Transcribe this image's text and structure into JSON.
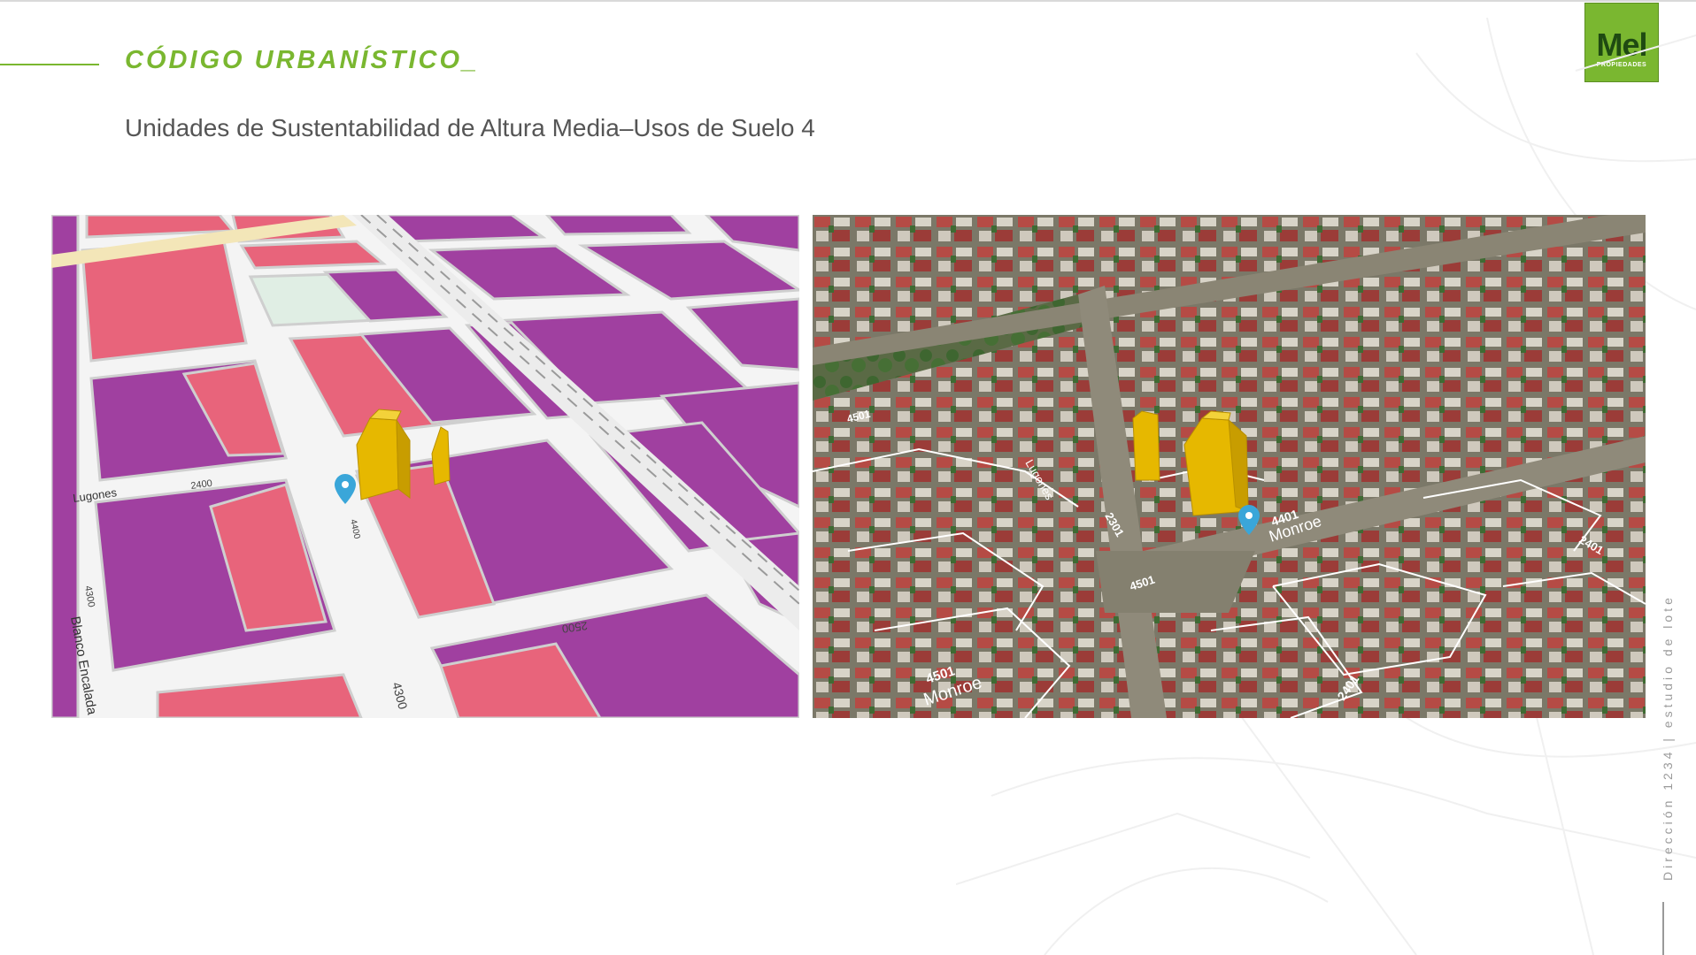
{
  "header": {
    "section_title": "CÓDIGO URBANÍSTICO_",
    "subtitle": "Unidades de Sustentabilidad de Altura Media–Usos de Suelo 4"
  },
  "logo": {
    "main": "Mel",
    "sub": "PROPIEDADES"
  },
  "map": {
    "labels": {
      "lugones": "Lugones",
      "blanco": "Blanco Encalada",
      "n2400": "2400",
      "n4300a": "4300",
      "n4300b": "4300",
      "n2500": "2500",
      "n4400": "4400"
    },
    "colors": {
      "purple": "#a040a0",
      "salmon": "#e8647b",
      "street": "#f4f4f4",
      "curb": "#cfcfcf",
      "building": "#e6b800"
    }
  },
  "aerial": {
    "labels": {
      "monroe_a": "Monroe",
      "monroe_b": "Monroe",
      "n4501a": "4501",
      "n4501b": "4501",
      "n4401": "4401",
      "n2401a": "2401",
      "n2401b": "2401",
      "n2301": "2301",
      "n4501c": "4501",
      "lugones": "Lugones"
    }
  },
  "footer": {
    "side_text": "Dirección 1234 | estudio de lote"
  },
  "icons": {
    "pin": "map-pin-icon"
  }
}
